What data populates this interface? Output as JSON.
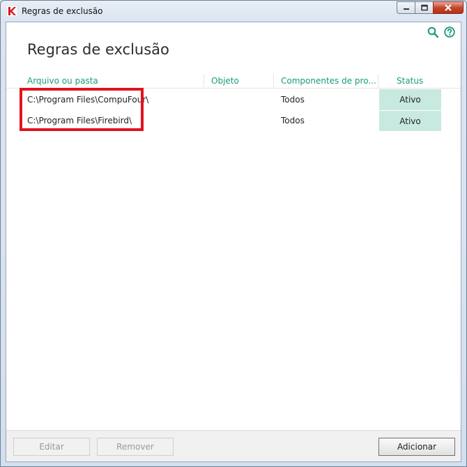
{
  "window": {
    "title": "Regras de exclusão"
  },
  "page": {
    "title": "Regras de exclusão",
    "icons": [
      "search-icon",
      "help-icon"
    ],
    "accent_color": "#1a9a7c"
  },
  "table": {
    "columns": [
      "Arquivo ou pasta",
      "Objeto",
      "Componentes de pro...",
      "Status"
    ],
    "rows": [
      {
        "path": "C:\\Program Files\\CompuFour\\",
        "object": "",
        "components": "Todos",
        "status": "Ativo"
      },
      {
        "path": "C:\\Program Files\\Firebird\\",
        "object": "",
        "components": "Todos",
        "status": "Ativo"
      }
    ],
    "status_color": "#c8e9e0"
  },
  "footer": {
    "edit_label": "Editar",
    "remove_label": "Remover",
    "add_label": "Adicionar"
  },
  "annotation": {
    "highlight_color": "#e0141e"
  }
}
